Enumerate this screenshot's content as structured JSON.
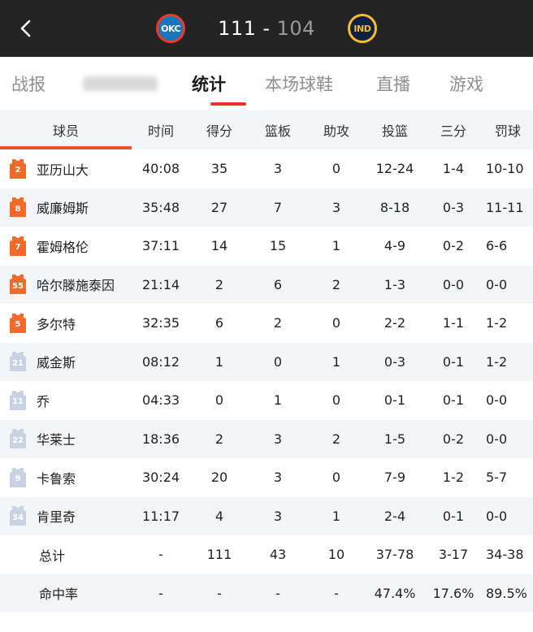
{
  "header": {
    "home_team_logo": "OKC",
    "away_team_logo": "IND",
    "home_score": "111",
    "separator": "-",
    "away_score": "104"
  },
  "tabs": [
    {
      "label": "战报",
      "active": false
    },
    {
      "label": "",
      "active": false,
      "blurred": true
    },
    {
      "label": "统计",
      "active": true
    },
    {
      "label": "本场球鞋",
      "active": false
    },
    {
      "label": "直播",
      "active": false
    },
    {
      "label": "游戏",
      "active": false
    }
  ],
  "table": {
    "headers": {
      "player": "球员",
      "time": "时间",
      "pts": "得分",
      "reb": "篮板",
      "ast": "助攻",
      "fg": "投篮",
      "three": "三分",
      "ft": "罚球"
    },
    "rows": [
      {
        "num": "2",
        "starter": true,
        "name": "亚历山大",
        "time": "40:08",
        "pts": "35",
        "reb": "3",
        "ast": "0",
        "fg": "12-24",
        "three": "1-4",
        "ft": "10-10"
      },
      {
        "num": "8",
        "starter": true,
        "name": "威廉姆斯",
        "time": "35:48",
        "pts": "27",
        "reb": "7",
        "ast": "3",
        "fg": "8-18",
        "three": "0-3",
        "ft": "11-11"
      },
      {
        "num": "7",
        "starter": true,
        "name": "霍姆格伦",
        "time": "37:11",
        "pts": "14",
        "reb": "15",
        "ast": "1",
        "fg": "4-9",
        "three": "0-2",
        "ft": "6-6"
      },
      {
        "num": "55",
        "starter": true,
        "name": "哈尔滕施泰因",
        "time": "21:14",
        "pts": "2",
        "reb": "6",
        "ast": "2",
        "fg": "1-3",
        "three": "0-0",
        "ft": "0-0"
      },
      {
        "num": "5",
        "starter": true,
        "name": "多尔特",
        "time": "32:35",
        "pts": "6",
        "reb": "2",
        "ast": "0",
        "fg": "2-2",
        "three": "1-1",
        "ft": "1-2"
      },
      {
        "num": "21",
        "starter": false,
        "name": "威金斯",
        "time": "08:12",
        "pts": "1",
        "reb": "0",
        "ast": "1",
        "fg": "0-3",
        "three": "0-1",
        "ft": "1-2"
      },
      {
        "num": "11",
        "starter": false,
        "name": "乔",
        "time": "04:33",
        "pts": "0",
        "reb": "1",
        "ast": "0",
        "fg": "0-1",
        "three": "0-1",
        "ft": "0-0"
      },
      {
        "num": "22",
        "starter": false,
        "name": "华莱士",
        "time": "18:36",
        "pts": "2",
        "reb": "3",
        "ast": "2",
        "fg": "1-5",
        "three": "0-2",
        "ft": "0-0"
      },
      {
        "num": "9",
        "starter": false,
        "name": "卡鲁索",
        "time": "30:24",
        "pts": "20",
        "reb": "3",
        "ast": "0",
        "fg": "7-9",
        "three": "1-2",
        "ft": "5-7"
      },
      {
        "num": "34",
        "starter": false,
        "name": "肯里奇",
        "time": "11:17",
        "pts": "4",
        "reb": "3",
        "ast": "1",
        "fg": "2-4",
        "three": "0-1",
        "ft": "0-0"
      }
    ],
    "totals": {
      "label": "总计",
      "time": "-",
      "pts": "111",
      "reb": "43",
      "ast": "10",
      "fg": "37-78",
      "three": "3-17",
      "ft": "34-38"
    },
    "percent": {
      "label": "命中率",
      "time": "-",
      "pts": "-",
      "reb": "-",
      "ast": "-",
      "fg": "47.4%",
      "three": "17.6%",
      "ft": "89.5%"
    }
  },
  "colors": {
    "starter_jersey": "#f06a2a",
    "bench_jersey": "#c9d2e3",
    "accent": "#e8322a"
  }
}
